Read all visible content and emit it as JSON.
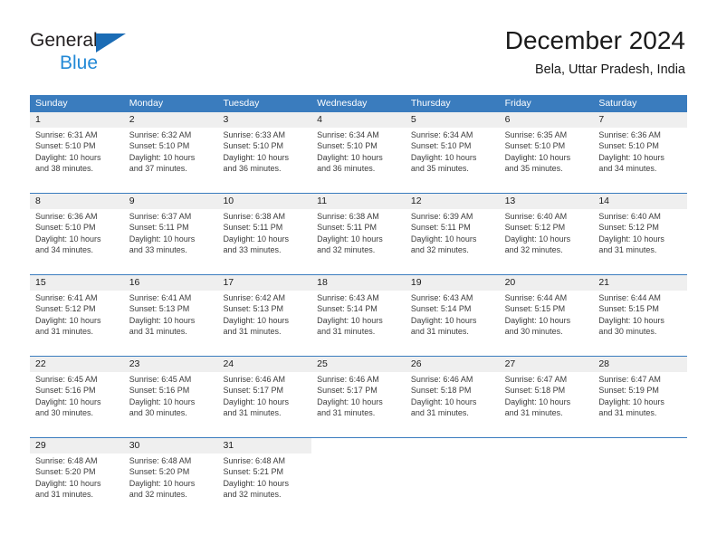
{
  "brand": {
    "name_part1": "General",
    "name_part2": "Blue",
    "triangle_color": "#1b6cb5",
    "blue_text_color": "#2389d6"
  },
  "header": {
    "title": "December 2024",
    "subtitle": "Bela, Uttar Pradesh, India",
    "header_bg_color": "#3a7cbe",
    "daynum_band_color": "#efefef"
  },
  "weekdays": [
    "Sunday",
    "Monday",
    "Tuesday",
    "Wednesday",
    "Thursday",
    "Friday",
    "Saturday"
  ],
  "labels": {
    "sunrise_prefix": "Sunrise:",
    "sunset_prefix": "Sunset:",
    "daylight_prefix": "Daylight:"
  },
  "weeks": [
    [
      {
        "day": "1",
        "sunrise": "Sunrise: 6:31 AM",
        "sunset": "Sunset: 5:10 PM",
        "daylight_line1": "Daylight: 10 hours",
        "daylight_line2": "and 38 minutes."
      },
      {
        "day": "2",
        "sunrise": "Sunrise: 6:32 AM",
        "sunset": "Sunset: 5:10 PM",
        "daylight_line1": "Daylight: 10 hours",
        "daylight_line2": "and 37 minutes."
      },
      {
        "day": "3",
        "sunrise": "Sunrise: 6:33 AM",
        "sunset": "Sunset: 5:10 PM",
        "daylight_line1": "Daylight: 10 hours",
        "daylight_line2": "and 36 minutes."
      },
      {
        "day": "4",
        "sunrise": "Sunrise: 6:34 AM",
        "sunset": "Sunset: 5:10 PM",
        "daylight_line1": "Daylight: 10 hours",
        "daylight_line2": "and 36 minutes."
      },
      {
        "day": "5",
        "sunrise": "Sunrise: 6:34 AM",
        "sunset": "Sunset: 5:10 PM",
        "daylight_line1": "Daylight: 10 hours",
        "daylight_line2": "and 35 minutes."
      },
      {
        "day": "6",
        "sunrise": "Sunrise: 6:35 AM",
        "sunset": "Sunset: 5:10 PM",
        "daylight_line1": "Daylight: 10 hours",
        "daylight_line2": "and 35 minutes."
      },
      {
        "day": "7",
        "sunrise": "Sunrise: 6:36 AM",
        "sunset": "Sunset: 5:10 PM",
        "daylight_line1": "Daylight: 10 hours",
        "daylight_line2": "and 34 minutes."
      }
    ],
    [
      {
        "day": "8",
        "sunrise": "Sunrise: 6:36 AM",
        "sunset": "Sunset: 5:10 PM",
        "daylight_line1": "Daylight: 10 hours",
        "daylight_line2": "and 34 minutes."
      },
      {
        "day": "9",
        "sunrise": "Sunrise: 6:37 AM",
        "sunset": "Sunset: 5:11 PM",
        "daylight_line1": "Daylight: 10 hours",
        "daylight_line2": "and 33 minutes."
      },
      {
        "day": "10",
        "sunrise": "Sunrise: 6:38 AM",
        "sunset": "Sunset: 5:11 PM",
        "daylight_line1": "Daylight: 10 hours",
        "daylight_line2": "and 33 minutes."
      },
      {
        "day": "11",
        "sunrise": "Sunrise: 6:38 AM",
        "sunset": "Sunset: 5:11 PM",
        "daylight_line1": "Daylight: 10 hours",
        "daylight_line2": "and 32 minutes."
      },
      {
        "day": "12",
        "sunrise": "Sunrise: 6:39 AM",
        "sunset": "Sunset: 5:11 PM",
        "daylight_line1": "Daylight: 10 hours",
        "daylight_line2": "and 32 minutes."
      },
      {
        "day": "13",
        "sunrise": "Sunrise: 6:40 AM",
        "sunset": "Sunset: 5:12 PM",
        "daylight_line1": "Daylight: 10 hours",
        "daylight_line2": "and 32 minutes."
      },
      {
        "day": "14",
        "sunrise": "Sunrise: 6:40 AM",
        "sunset": "Sunset: 5:12 PM",
        "daylight_line1": "Daylight: 10 hours",
        "daylight_line2": "and 31 minutes."
      }
    ],
    [
      {
        "day": "15",
        "sunrise": "Sunrise: 6:41 AM",
        "sunset": "Sunset: 5:12 PM",
        "daylight_line1": "Daylight: 10 hours",
        "daylight_line2": "and 31 minutes."
      },
      {
        "day": "16",
        "sunrise": "Sunrise: 6:41 AM",
        "sunset": "Sunset: 5:13 PM",
        "daylight_line1": "Daylight: 10 hours",
        "daylight_line2": "and 31 minutes."
      },
      {
        "day": "17",
        "sunrise": "Sunrise: 6:42 AM",
        "sunset": "Sunset: 5:13 PM",
        "daylight_line1": "Daylight: 10 hours",
        "daylight_line2": "and 31 minutes."
      },
      {
        "day": "18",
        "sunrise": "Sunrise: 6:43 AM",
        "sunset": "Sunset: 5:14 PM",
        "daylight_line1": "Daylight: 10 hours",
        "daylight_line2": "and 31 minutes."
      },
      {
        "day": "19",
        "sunrise": "Sunrise: 6:43 AM",
        "sunset": "Sunset: 5:14 PM",
        "daylight_line1": "Daylight: 10 hours",
        "daylight_line2": "and 31 minutes."
      },
      {
        "day": "20",
        "sunrise": "Sunrise: 6:44 AM",
        "sunset": "Sunset: 5:15 PM",
        "daylight_line1": "Daylight: 10 hours",
        "daylight_line2": "and 30 minutes."
      },
      {
        "day": "21",
        "sunrise": "Sunrise: 6:44 AM",
        "sunset": "Sunset: 5:15 PM",
        "daylight_line1": "Daylight: 10 hours",
        "daylight_line2": "and 30 minutes."
      }
    ],
    [
      {
        "day": "22",
        "sunrise": "Sunrise: 6:45 AM",
        "sunset": "Sunset: 5:16 PM",
        "daylight_line1": "Daylight: 10 hours",
        "daylight_line2": "and 30 minutes."
      },
      {
        "day": "23",
        "sunrise": "Sunrise: 6:45 AM",
        "sunset": "Sunset: 5:16 PM",
        "daylight_line1": "Daylight: 10 hours",
        "daylight_line2": "and 30 minutes."
      },
      {
        "day": "24",
        "sunrise": "Sunrise: 6:46 AM",
        "sunset": "Sunset: 5:17 PM",
        "daylight_line1": "Daylight: 10 hours",
        "daylight_line2": "and 31 minutes."
      },
      {
        "day": "25",
        "sunrise": "Sunrise: 6:46 AM",
        "sunset": "Sunset: 5:17 PM",
        "daylight_line1": "Daylight: 10 hours",
        "daylight_line2": "and 31 minutes."
      },
      {
        "day": "26",
        "sunrise": "Sunrise: 6:46 AM",
        "sunset": "Sunset: 5:18 PM",
        "daylight_line1": "Daylight: 10 hours",
        "daylight_line2": "and 31 minutes."
      },
      {
        "day": "27",
        "sunrise": "Sunrise: 6:47 AM",
        "sunset": "Sunset: 5:18 PM",
        "daylight_line1": "Daylight: 10 hours",
        "daylight_line2": "and 31 minutes."
      },
      {
        "day": "28",
        "sunrise": "Sunrise: 6:47 AM",
        "sunset": "Sunset: 5:19 PM",
        "daylight_line1": "Daylight: 10 hours",
        "daylight_line2": "and 31 minutes."
      }
    ],
    [
      {
        "day": "29",
        "sunrise": "Sunrise: 6:48 AM",
        "sunset": "Sunset: 5:20 PM",
        "daylight_line1": "Daylight: 10 hours",
        "daylight_line2": "and 31 minutes."
      },
      {
        "day": "30",
        "sunrise": "Sunrise: 6:48 AM",
        "sunset": "Sunset: 5:20 PM",
        "daylight_line1": "Daylight: 10 hours",
        "daylight_line2": "and 32 minutes."
      },
      {
        "day": "31",
        "sunrise": "Sunrise: 6:48 AM",
        "sunset": "Sunset: 5:21 PM",
        "daylight_line1": "Daylight: 10 hours",
        "daylight_line2": "and 32 minutes."
      },
      {
        "day": "",
        "sunrise": "",
        "sunset": "",
        "daylight_line1": "",
        "daylight_line2": ""
      },
      {
        "day": "",
        "sunrise": "",
        "sunset": "",
        "daylight_line1": "",
        "daylight_line2": ""
      },
      {
        "day": "",
        "sunrise": "",
        "sunset": "",
        "daylight_line1": "",
        "daylight_line2": ""
      },
      {
        "day": "",
        "sunrise": "",
        "sunset": "",
        "daylight_line1": "",
        "daylight_line2": ""
      }
    ]
  ]
}
